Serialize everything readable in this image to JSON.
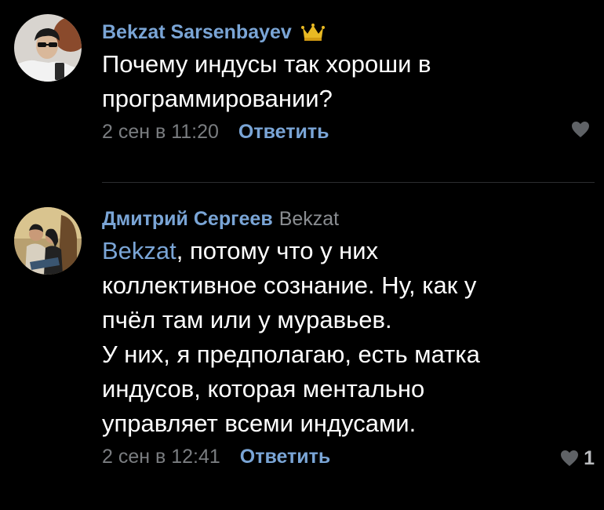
{
  "comments": [
    {
      "author": "Bekzat Sarsenbayev",
      "has_crown": true,
      "text_lines": [
        "Почему индусы так хороши в",
        "программировании?"
      ],
      "date": "2 сен в 11:20",
      "reply_label": "Ответить",
      "likes": ""
    },
    {
      "author": "Дмитрий Сергеев",
      "reply_to": "Bekzat",
      "mention": "Bekzat",
      "first_line_rest": ", потому что у них",
      "text_lines": [
        "коллективное сознание. Ну, как у",
        "пчёл там или у муравьев.",
        "У них, я предполагаю, есть матка",
        "индусов, которая ментально",
        "управляет всеми индусами."
      ],
      "date": "2 сен в 12:41",
      "reply_label": "Ответить",
      "likes": "1"
    }
  ],
  "colors": {
    "background": "#000000",
    "link": "#7aa5d6",
    "muted": "#7a7d80",
    "text": "#ffffff"
  },
  "icons": [
    "crown-icon",
    "heart-icon"
  ]
}
